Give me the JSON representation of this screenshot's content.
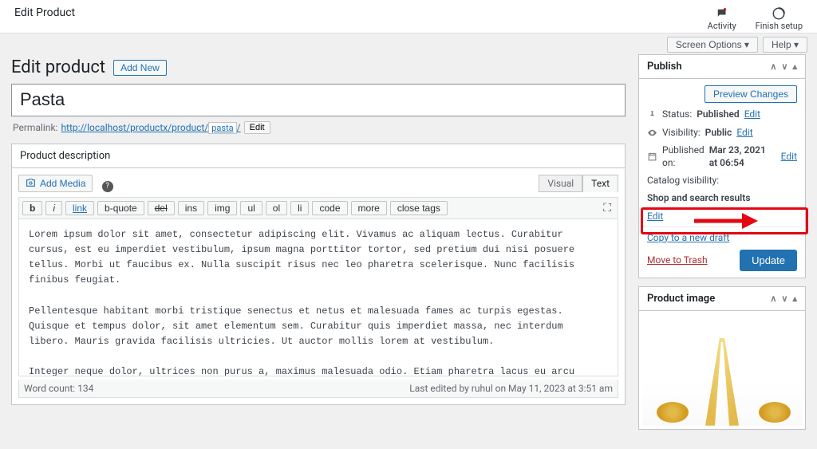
{
  "topbar": {
    "title": "Edit Product",
    "activity": "Activity",
    "finish_setup": "Finish setup"
  },
  "util": {
    "screen_options": "Screen Options ▾",
    "help": "Help ▾"
  },
  "page": {
    "heading": "Edit product",
    "add_new": "Add New"
  },
  "title_input": "Pasta",
  "permalink": {
    "label": "Permalink:",
    "base": "http://localhost/productx/product/",
    "slug": "pasta",
    "trail": "/",
    "edit": "Edit"
  },
  "editor": {
    "panel_title": "Product description",
    "add_media": "Add Media",
    "tab_visual": "Visual",
    "tab_text": "Text",
    "buttons": {
      "b": "b",
      "i": "i",
      "link": "link",
      "bquote": "b-quote",
      "del": "del",
      "ins": "ins",
      "img": "img",
      "ul": "ul",
      "ol": "ol",
      "li": "li",
      "code": "code",
      "more": "more",
      "close": "close tags"
    },
    "content": "Lorem ipsum dolor sit amet, consectetur adipiscing elit. Vivamus ac aliquam lectus. Curabitur cursus, est eu imperdiet vestibulum, ipsum magna porttitor tortor, sed pretium dui nisi posuere tellus. Morbi ut faucibus ex. Nulla suscipit risus nec leo pharetra scelerisque. Nunc facilisis finibus feugiat.\n\nPellentesque habitant morbi tristique senectus et netus et malesuada fames ac turpis egestas. Quisque et tempus dolor, sit amet elementum sem. Curabitur quis imperdiet massa, nec interdum libero. Mauris gravida facilisis ultricies. Ut auctor mollis lorem at vestibulum.\n\nInteger neque dolor, ultrices non purus a, maximus malesuada odio. Etiam pharetra lacus eu arcu commodo dictum. Phasellus eleifend erat quis hendrerit dictum. Donec feugiat in arcu nec dictum. Sed bibendum venenatis arcu id posuere. Suspendisse ac tempus massa, id congue justo. Etiam neque eget orci vehicula sollicitudin. Curabitur ac pharetra neque.",
    "word_count": "Word count: 134",
    "last_edited": "Last edited by ruhul on May 11, 2023 at 3:51 am"
  },
  "publish": {
    "title": "Publish",
    "preview": "Preview Changes",
    "status_label": "Status:",
    "status_value": "Published",
    "visibility_label": "Visibility:",
    "visibility_value": "Public",
    "published_label": "Published on:",
    "published_value": "Mar 23, 2021 at 06:54",
    "catalog_label": "Catalog visibility:",
    "catalog_value": "Shop and search results",
    "edit": "Edit",
    "copy": "Copy to a new draft",
    "trash": "Move to Trash",
    "update": "Update"
  },
  "product_image": {
    "title": "Product image"
  },
  "colors": {
    "primary": "#2271b1",
    "danger": "#b32d2e",
    "highlight": "#e30613"
  }
}
